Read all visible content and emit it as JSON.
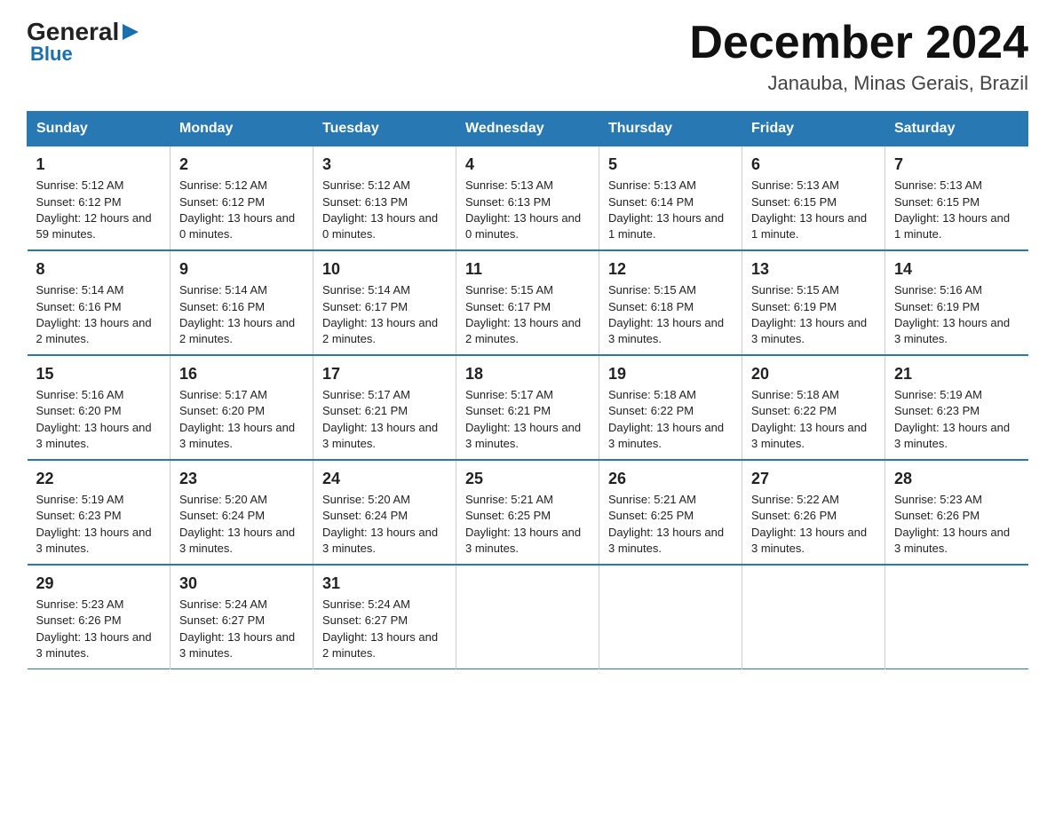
{
  "logo": {
    "general": "General",
    "blue": "Blue",
    "arrow": "▶"
  },
  "title": {
    "month": "December 2024",
    "location": "Janauba, Minas Gerais, Brazil"
  },
  "headers": [
    "Sunday",
    "Monday",
    "Tuesday",
    "Wednesday",
    "Thursday",
    "Friday",
    "Saturday"
  ],
  "weeks": [
    [
      {
        "day": "1",
        "sunrise": "Sunrise: 5:12 AM",
        "sunset": "Sunset: 6:12 PM",
        "daylight": "Daylight: 12 hours and 59 minutes."
      },
      {
        "day": "2",
        "sunrise": "Sunrise: 5:12 AM",
        "sunset": "Sunset: 6:12 PM",
        "daylight": "Daylight: 13 hours and 0 minutes."
      },
      {
        "day": "3",
        "sunrise": "Sunrise: 5:12 AM",
        "sunset": "Sunset: 6:13 PM",
        "daylight": "Daylight: 13 hours and 0 minutes."
      },
      {
        "day": "4",
        "sunrise": "Sunrise: 5:13 AM",
        "sunset": "Sunset: 6:13 PM",
        "daylight": "Daylight: 13 hours and 0 minutes."
      },
      {
        "day": "5",
        "sunrise": "Sunrise: 5:13 AM",
        "sunset": "Sunset: 6:14 PM",
        "daylight": "Daylight: 13 hours and 1 minute."
      },
      {
        "day": "6",
        "sunrise": "Sunrise: 5:13 AM",
        "sunset": "Sunset: 6:15 PM",
        "daylight": "Daylight: 13 hours and 1 minute."
      },
      {
        "day": "7",
        "sunrise": "Sunrise: 5:13 AM",
        "sunset": "Sunset: 6:15 PM",
        "daylight": "Daylight: 13 hours and 1 minute."
      }
    ],
    [
      {
        "day": "8",
        "sunrise": "Sunrise: 5:14 AM",
        "sunset": "Sunset: 6:16 PM",
        "daylight": "Daylight: 13 hours and 2 minutes."
      },
      {
        "day": "9",
        "sunrise": "Sunrise: 5:14 AM",
        "sunset": "Sunset: 6:16 PM",
        "daylight": "Daylight: 13 hours and 2 minutes."
      },
      {
        "day": "10",
        "sunrise": "Sunrise: 5:14 AM",
        "sunset": "Sunset: 6:17 PM",
        "daylight": "Daylight: 13 hours and 2 minutes."
      },
      {
        "day": "11",
        "sunrise": "Sunrise: 5:15 AM",
        "sunset": "Sunset: 6:17 PM",
        "daylight": "Daylight: 13 hours and 2 minutes."
      },
      {
        "day": "12",
        "sunrise": "Sunrise: 5:15 AM",
        "sunset": "Sunset: 6:18 PM",
        "daylight": "Daylight: 13 hours and 3 minutes."
      },
      {
        "day": "13",
        "sunrise": "Sunrise: 5:15 AM",
        "sunset": "Sunset: 6:19 PM",
        "daylight": "Daylight: 13 hours and 3 minutes."
      },
      {
        "day": "14",
        "sunrise": "Sunrise: 5:16 AM",
        "sunset": "Sunset: 6:19 PM",
        "daylight": "Daylight: 13 hours and 3 minutes."
      }
    ],
    [
      {
        "day": "15",
        "sunrise": "Sunrise: 5:16 AM",
        "sunset": "Sunset: 6:20 PM",
        "daylight": "Daylight: 13 hours and 3 minutes."
      },
      {
        "day": "16",
        "sunrise": "Sunrise: 5:17 AM",
        "sunset": "Sunset: 6:20 PM",
        "daylight": "Daylight: 13 hours and 3 minutes."
      },
      {
        "day": "17",
        "sunrise": "Sunrise: 5:17 AM",
        "sunset": "Sunset: 6:21 PM",
        "daylight": "Daylight: 13 hours and 3 minutes."
      },
      {
        "day": "18",
        "sunrise": "Sunrise: 5:17 AM",
        "sunset": "Sunset: 6:21 PM",
        "daylight": "Daylight: 13 hours and 3 minutes."
      },
      {
        "day": "19",
        "sunrise": "Sunrise: 5:18 AM",
        "sunset": "Sunset: 6:22 PM",
        "daylight": "Daylight: 13 hours and 3 minutes."
      },
      {
        "day": "20",
        "sunrise": "Sunrise: 5:18 AM",
        "sunset": "Sunset: 6:22 PM",
        "daylight": "Daylight: 13 hours and 3 minutes."
      },
      {
        "day": "21",
        "sunrise": "Sunrise: 5:19 AM",
        "sunset": "Sunset: 6:23 PM",
        "daylight": "Daylight: 13 hours and 3 minutes."
      }
    ],
    [
      {
        "day": "22",
        "sunrise": "Sunrise: 5:19 AM",
        "sunset": "Sunset: 6:23 PM",
        "daylight": "Daylight: 13 hours and 3 minutes."
      },
      {
        "day": "23",
        "sunrise": "Sunrise: 5:20 AM",
        "sunset": "Sunset: 6:24 PM",
        "daylight": "Daylight: 13 hours and 3 minutes."
      },
      {
        "day": "24",
        "sunrise": "Sunrise: 5:20 AM",
        "sunset": "Sunset: 6:24 PM",
        "daylight": "Daylight: 13 hours and 3 minutes."
      },
      {
        "day": "25",
        "sunrise": "Sunrise: 5:21 AM",
        "sunset": "Sunset: 6:25 PM",
        "daylight": "Daylight: 13 hours and 3 minutes."
      },
      {
        "day": "26",
        "sunrise": "Sunrise: 5:21 AM",
        "sunset": "Sunset: 6:25 PM",
        "daylight": "Daylight: 13 hours and 3 minutes."
      },
      {
        "day": "27",
        "sunrise": "Sunrise: 5:22 AM",
        "sunset": "Sunset: 6:26 PM",
        "daylight": "Daylight: 13 hours and 3 minutes."
      },
      {
        "day": "28",
        "sunrise": "Sunrise: 5:23 AM",
        "sunset": "Sunset: 6:26 PM",
        "daylight": "Daylight: 13 hours and 3 minutes."
      }
    ],
    [
      {
        "day": "29",
        "sunrise": "Sunrise: 5:23 AM",
        "sunset": "Sunset: 6:26 PM",
        "daylight": "Daylight: 13 hours and 3 minutes."
      },
      {
        "day": "30",
        "sunrise": "Sunrise: 5:24 AM",
        "sunset": "Sunset: 6:27 PM",
        "daylight": "Daylight: 13 hours and 3 minutes."
      },
      {
        "day": "31",
        "sunrise": "Sunrise: 5:24 AM",
        "sunset": "Sunset: 6:27 PM",
        "daylight": "Daylight: 13 hours and 2 minutes."
      },
      {
        "day": "",
        "sunrise": "",
        "sunset": "",
        "daylight": ""
      },
      {
        "day": "",
        "sunrise": "",
        "sunset": "",
        "daylight": ""
      },
      {
        "day": "",
        "sunrise": "",
        "sunset": "",
        "daylight": ""
      },
      {
        "day": "",
        "sunrise": "",
        "sunset": "",
        "daylight": ""
      }
    ]
  ]
}
